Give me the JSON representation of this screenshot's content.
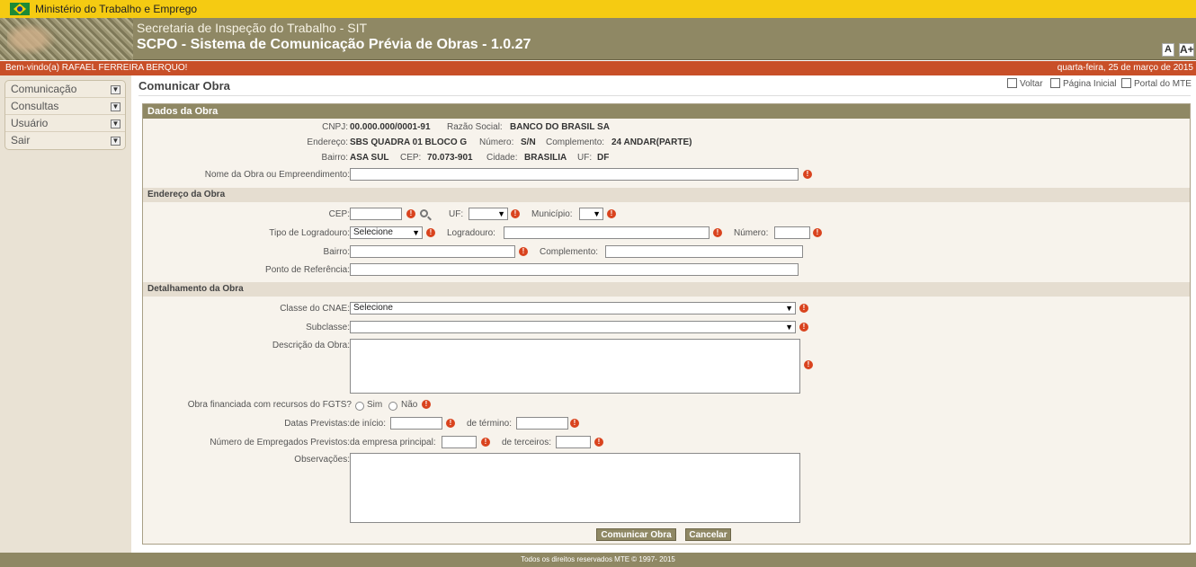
{
  "gov_bar": {
    "title": "Ministério do Trabalho e Emprego"
  },
  "header": {
    "subtitle": "Secretaria de Inspeção do Trabalho - SIT",
    "system": "SCPO - Sistema de Comunicação Prévia de Obras - 1.0.27",
    "font_small": "A",
    "font_large": "A+"
  },
  "welcome": {
    "user": "Bem-vindo(a) RAFAEL FERREIRA BERQUO!",
    "date": "quarta-feira, 25 de março de 2015"
  },
  "sidebar": {
    "items": [
      {
        "label": "Comunicação"
      },
      {
        "label": "Consultas"
      },
      {
        "label": "Usuário"
      },
      {
        "label": "Sair"
      }
    ]
  },
  "page": {
    "title": "Comunicar Obra",
    "links": {
      "back": "Voltar",
      "home": "Página Inicial",
      "portal": "Portal do MTE"
    }
  },
  "dados_obra": {
    "heading": "Dados da Obra",
    "cnpj_label": "CNPJ:",
    "cnpj": "00.000.000/0001-91",
    "razao_label": "Razão Social:",
    "razao": "BANCO DO BRASIL SA",
    "endereco_label": "Endereço:",
    "endereco": "SBS QUADRA 01 BLOCO G",
    "numero_label": "Número:",
    "numero": "S/N",
    "complemento_label": "Complemento:",
    "complemento": "24 ANDAR(PARTE)",
    "bairro_label": "Bairro:",
    "bairro": "ASA SUL",
    "cep_label": "CEP:",
    "cep": "70.073-901",
    "cidade_label": "Cidade:",
    "cidade": "BRASILIA",
    "uf_label": "UF:",
    "uf": "DF",
    "nome_obra_label": "Nome da Obra ou Empreendimento:"
  },
  "endereco_obra": {
    "heading": "Endereço da Obra",
    "cep_label": "CEP:",
    "uf_label": "UF:",
    "municipio_label": "Município:",
    "tipo_logradouro_label": "Tipo de Logradouro:",
    "tipo_logradouro_value": "Selecione",
    "logradouro_label": "Logradouro:",
    "numero_label": "Número:",
    "bairro_label": "Bairro:",
    "complemento_label": "Complemento:",
    "ponto_referencia_label": "Ponto de Referência:"
  },
  "detalhamento": {
    "heading": "Detalhamento da Obra",
    "cnae_label": "Classe do CNAE:",
    "cnae_value": "Selecione",
    "subclasse_label": "Subclasse:",
    "descricao_label": "Descrição da Obra:",
    "fgts_label": "Obra financiada com recursos do FGTS?",
    "fgts_sim": "Sim",
    "fgts_nao": "Não",
    "datas_label": "Datas Previstas:",
    "inicio_label": "de início:",
    "termino_label": "de término:",
    "empregados_label": "Número de Empregados Previstos:",
    "empresa_principal_label": "da empresa principal:",
    "terceiros_label": "de terceiros:",
    "observacoes_label": "Observações:"
  },
  "buttons": {
    "submit": "Comunicar Obra",
    "cancel": "Cancelar"
  },
  "footer": {
    "text": "Todos os direitos reservados MTE © 1997- 2015"
  },
  "required_mark": "!",
  "dropdown_arrow": "▼",
  "colors": {
    "gov_bar": "#f5cb12",
    "header": "#8f8864",
    "welcome_bar": "#c84f28",
    "required": "#d9431e"
  }
}
